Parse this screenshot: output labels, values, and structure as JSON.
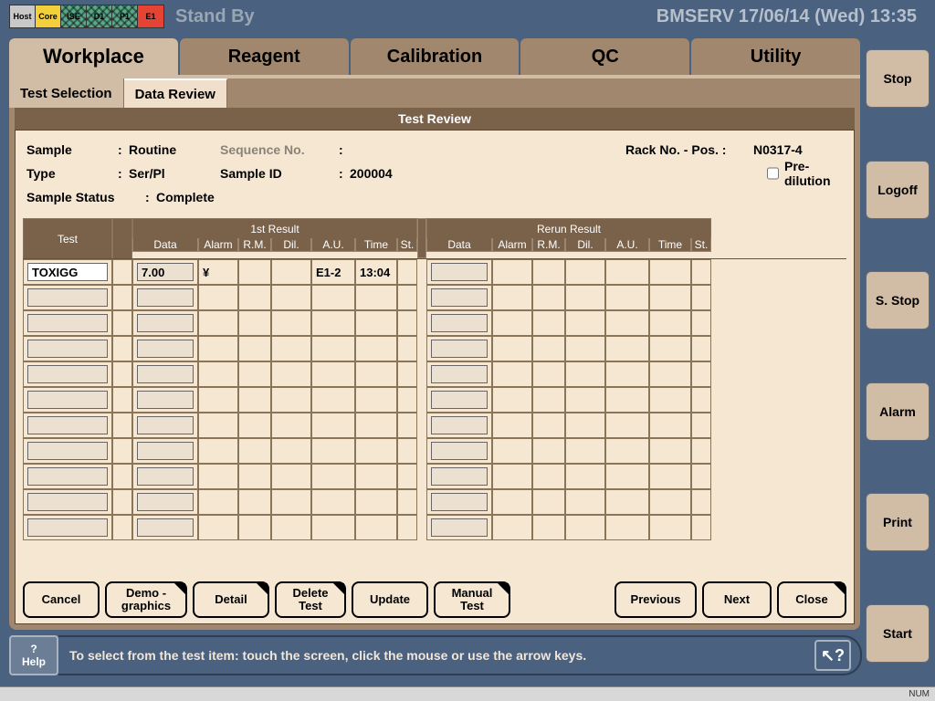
{
  "header": {
    "standby": "Stand By",
    "user": "BMSERV",
    "datetime": "17/06/14 (Wed) 13:35",
    "status_icons": [
      {
        "label": "Host",
        "bg": "#c8c8c8",
        "hatched": false
      },
      {
        "label": "Core",
        "bg": "#f3cf3a",
        "hatched": false
      },
      {
        "label": "ISE",
        "bg": "#5aa88a",
        "hatched": true
      },
      {
        "label": "D1",
        "bg": "#5aa88a",
        "hatched": true
      },
      {
        "label": "P1",
        "bg": "#5aa88a",
        "hatched": true
      },
      {
        "label": "E1",
        "bg": "#e54434",
        "hatched": false
      }
    ]
  },
  "tabs": {
    "main": [
      "Workplace",
      "Reagent",
      "Calibration",
      "QC",
      "Utility"
    ],
    "active_main": 0,
    "sub": [
      "Test Selection",
      "Data Review"
    ],
    "active_sub": 1
  },
  "panel": {
    "title": "Test Review",
    "sample_label": "Sample",
    "sample_value": "Routine",
    "type_label": "Type",
    "type_value": "Ser/Pl",
    "seq_label": "Sequence No.",
    "seq_value": "",
    "sampleid_label": "Sample ID",
    "sampleid_value": "200004",
    "status_label": "Sample Status",
    "status_value": "Complete",
    "rack_label": "Rack No. - Pos.  :",
    "rack_value": "N0317-4",
    "predilution_label": "Pre-dilution",
    "predilution_checked": false
  },
  "columns": {
    "test": "Test",
    "first_group": "1st Result",
    "rerun_group": "Rerun Result",
    "data": "Data",
    "alarm": "Alarm",
    "rm": "R.M.",
    "dil": "Dil.",
    "au": "A.U.",
    "time": "Time",
    "st": "St."
  },
  "rows": [
    {
      "test": "TOXIGG",
      "data1": "7.00",
      "alarm1": "¥",
      "rm1": "",
      "dil1": "",
      "au1": "E1-2",
      "time1": "13:04",
      "st1": "",
      "data2": "",
      "alarm2": "",
      "rm2": "",
      "dil2": "",
      "au2": "",
      "time2": "",
      "st2": ""
    },
    {
      "test": "",
      "data1": "",
      "alarm1": "",
      "rm1": "",
      "dil1": "",
      "au1": "",
      "time1": "",
      "st1": "",
      "data2": "",
      "alarm2": "",
      "rm2": "",
      "dil2": "",
      "au2": "",
      "time2": "",
      "st2": ""
    },
    {
      "test": "",
      "data1": "",
      "alarm1": "",
      "rm1": "",
      "dil1": "",
      "au1": "",
      "time1": "",
      "st1": "",
      "data2": "",
      "alarm2": "",
      "rm2": "",
      "dil2": "",
      "au2": "",
      "time2": "",
      "st2": ""
    },
    {
      "test": "",
      "data1": "",
      "alarm1": "",
      "rm1": "",
      "dil1": "",
      "au1": "",
      "time1": "",
      "st1": "",
      "data2": "",
      "alarm2": "",
      "rm2": "",
      "dil2": "",
      "au2": "",
      "time2": "",
      "st2": ""
    },
    {
      "test": "",
      "data1": "",
      "alarm1": "",
      "rm1": "",
      "dil1": "",
      "au1": "",
      "time1": "",
      "st1": "",
      "data2": "",
      "alarm2": "",
      "rm2": "",
      "dil2": "",
      "au2": "",
      "time2": "",
      "st2": ""
    },
    {
      "test": "",
      "data1": "",
      "alarm1": "",
      "rm1": "",
      "dil1": "",
      "au1": "",
      "time1": "",
      "st1": "",
      "data2": "",
      "alarm2": "",
      "rm2": "",
      "dil2": "",
      "au2": "",
      "time2": "",
      "st2": ""
    },
    {
      "test": "",
      "data1": "",
      "alarm1": "",
      "rm1": "",
      "dil1": "",
      "au1": "",
      "time1": "",
      "st1": "",
      "data2": "",
      "alarm2": "",
      "rm2": "",
      "dil2": "",
      "au2": "",
      "time2": "",
      "st2": ""
    },
    {
      "test": "",
      "data1": "",
      "alarm1": "",
      "rm1": "",
      "dil1": "",
      "au1": "",
      "time1": "",
      "st1": "",
      "data2": "",
      "alarm2": "",
      "rm2": "",
      "dil2": "",
      "au2": "",
      "time2": "",
      "st2": ""
    },
    {
      "test": "",
      "data1": "",
      "alarm1": "",
      "rm1": "",
      "dil1": "",
      "au1": "",
      "time1": "",
      "st1": "",
      "data2": "",
      "alarm2": "",
      "rm2": "",
      "dil2": "",
      "au2": "",
      "time2": "",
      "st2": ""
    },
    {
      "test": "",
      "data1": "",
      "alarm1": "",
      "rm1": "",
      "dil1": "",
      "au1": "",
      "time1": "",
      "st1": "",
      "data2": "",
      "alarm2": "",
      "rm2": "",
      "dil2": "",
      "au2": "",
      "time2": "",
      "st2": ""
    },
    {
      "test": "",
      "data1": "",
      "alarm1": "",
      "rm1": "",
      "dil1": "",
      "au1": "",
      "time1": "",
      "st1": "",
      "data2": "",
      "alarm2": "",
      "rm2": "",
      "dil2": "",
      "au2": "",
      "time2": "",
      "st2": ""
    }
  ],
  "buttons": {
    "cancel": "Cancel",
    "demographics": "Demo -\ngraphics",
    "detail": "Detail",
    "delete_test": "Delete\nTest",
    "update": "Update",
    "manual_test": "Manual\nTest",
    "previous": "Previous",
    "next": "Next",
    "close": "Close"
  },
  "right": {
    "stop": "Stop",
    "logoff": "Logoff",
    "sstop": "S. Stop",
    "alarm": "Alarm",
    "print": "Print",
    "start": "Start"
  },
  "help": {
    "btn_q": "?",
    "btn_label": "Help",
    "message": "To select from the test item: touch the screen, click the mouse or use the arrow keys."
  },
  "statusbar": {
    "num": "NUM"
  }
}
